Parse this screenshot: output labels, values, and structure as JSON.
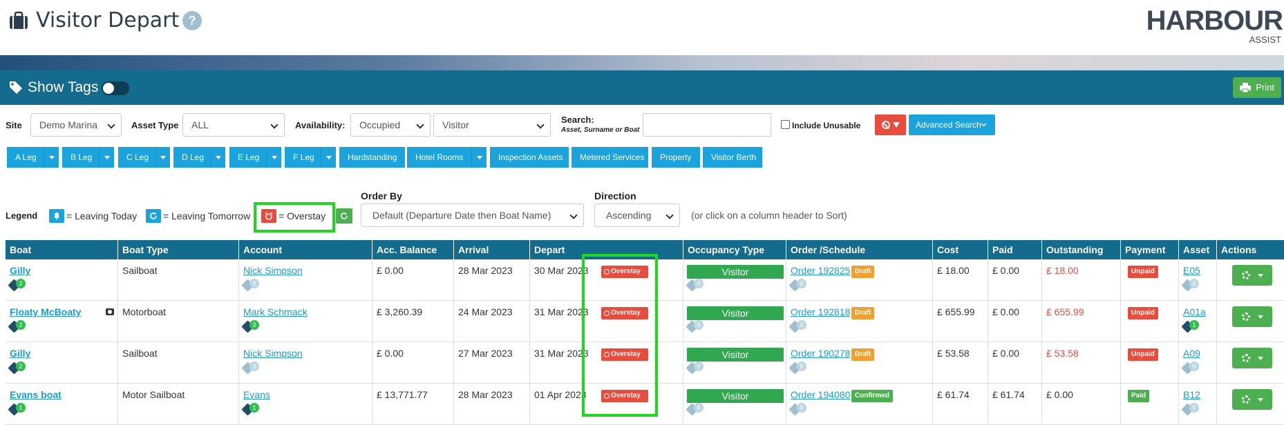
{
  "page": {
    "title": "Visitor Depart",
    "help": "?"
  },
  "logo": {
    "main": "HARBOUR",
    "sub": "ASSIST"
  },
  "tagbar": {
    "show_tags": "Show Tags",
    "print": "Print"
  },
  "filters": {
    "site_label": "Site",
    "site_value": "Demo Marina",
    "asset_type_label": "Asset Type",
    "asset_type_value": "ALL",
    "availability_label": "Availability:",
    "availability_value": "Occupied",
    "availability_sub_value": "Visitor",
    "search_label": "Search:",
    "search_hint": "Asset, Surname or Boat",
    "search_value": "",
    "include_unusable": "Include Unusable",
    "advanced_search": "Advanced Search"
  },
  "asset_buttons": [
    {
      "label": "A Leg",
      "split": true
    },
    {
      "label": "B Leg",
      "split": true
    },
    {
      "label": "C Leg",
      "split": true
    },
    {
      "label": "D Leg",
      "split": true
    },
    {
      "label": "E Leg",
      "split": true
    },
    {
      "label": "F Leg",
      "split": true
    },
    {
      "label": "Hardstanding",
      "split": false
    },
    {
      "label": "Hotel Rooms",
      "split": true
    },
    {
      "label": "Inspection Assets",
      "split": false
    },
    {
      "label": "Metered Services",
      "split": false
    },
    {
      "label": "Property",
      "split": false
    },
    {
      "label": "Visitor Berth",
      "split": false
    }
  ],
  "legend": {
    "label": "Legend",
    "leaving_today": "= Leaving Today",
    "leaving_tomorrow": "= Leaving Tomorrow",
    "overstay": "= Overstay"
  },
  "order": {
    "order_by_label": "Order By",
    "order_by_value": "Default (Departure Date then Boat Name)",
    "direction_label": "Direction",
    "direction_value": "Ascending",
    "hint": "(or click on a column header to Sort)"
  },
  "table": {
    "headers": [
      "Boat",
      "Boat Type",
      "Account",
      "Acc. Balance",
      "Arrival",
      "Depart",
      "Occupancy Type",
      "Order /Schedule",
      "Cost",
      "Paid",
      "Outstanding",
      "Payment",
      "Asset",
      "Actions"
    ],
    "rows": [
      {
        "boat": "Gilly",
        "boat_tags": "2",
        "camera": false,
        "type": "Sailboat",
        "account": "Nick Simpson",
        "acc_tags": "0",
        "balance": "£ 0.00",
        "arrival": "28 Mar 2023",
        "depart": "30 Mar 2023",
        "overstay": "Overstay",
        "occupancy": "Visitor",
        "occ_tags": "0",
        "order": "Order 192825",
        "order_status": "Draft",
        "order_tags": "0",
        "cost": "£ 18.00",
        "paid": "£ 0.00",
        "outstanding": "£ 18.00",
        "outstanding_red": true,
        "payment": "Unpaid",
        "asset": "E05",
        "asset_tags": "0"
      },
      {
        "boat": "Floaty McBoaty",
        "boat_tags": "2",
        "camera": true,
        "type": "Motorboat",
        "account": "Mark Schmack",
        "acc_tags": "3",
        "balance": "£ 3,260.39",
        "arrival": "24 Mar 2023",
        "depart": "31 Mar 2023",
        "overstay": "Overstay",
        "occupancy": "Visitor",
        "occ_tags": "0",
        "order": "Order 192818",
        "order_status": "Draft",
        "order_tags": "0",
        "cost": "£ 655.99",
        "paid": "£ 0.00",
        "outstanding": "£ 655.99",
        "outstanding_red": true,
        "payment": "Unpaid",
        "asset": "A01a",
        "asset_tags": "1"
      },
      {
        "boat": "Gilly",
        "boat_tags": "2",
        "camera": false,
        "type": "Sailboat",
        "account": "Nick Simpson",
        "acc_tags": "0",
        "balance": "£ 0.00",
        "arrival": "27 Mar 2023",
        "depart": "31 Mar 2023",
        "overstay": "Overstay",
        "occupancy": "Visitor",
        "occ_tags": "0",
        "order": "Order 190278",
        "order_status": "Draft",
        "order_tags": "0",
        "cost": "£ 53.58",
        "paid": "£ 0.00",
        "outstanding": "£ 53.58",
        "outstanding_red": true,
        "payment": "Unpaid",
        "asset": "A09",
        "asset_tags": "0"
      },
      {
        "boat": "Evans boat",
        "boat_tags": "1",
        "camera": false,
        "type": "Motor Sailboat",
        "account": "Evans",
        "acc_tags": "1",
        "balance": "£ 13,771.77",
        "arrival": "28 Mar 2023",
        "depart": "01 Apr 2023",
        "overstay": "Overstay",
        "occupancy": "Visitor",
        "occ_tags": "0",
        "order": "Order 194080",
        "order_status": "Confirmed",
        "order_tags": "0",
        "cost": "£ 61.74",
        "paid": "£ 61.74",
        "outstanding": "£ 0.00",
        "outstanding_red": false,
        "payment": "Paid",
        "asset": "B12",
        "asset_tags": "0"
      }
    ]
  },
  "colors": {
    "header_bg": "#136b8d",
    "accent_blue": "#1aa3dd",
    "green": "#4cb050",
    "red": "#e74c3c",
    "highlight": "#1ed81e"
  }
}
